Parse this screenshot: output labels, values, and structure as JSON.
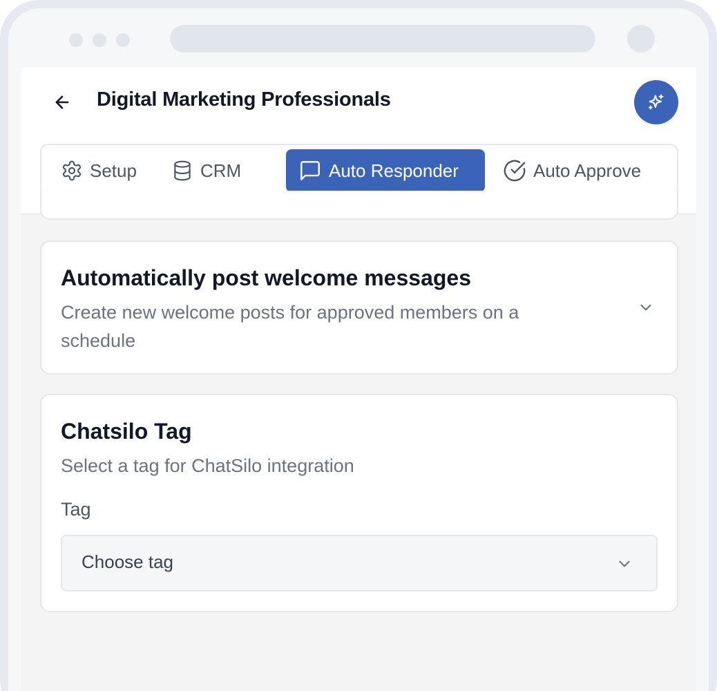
{
  "header": {
    "title": "Digital Marketing Professionals",
    "back_icon": "arrow-left-icon",
    "ai_icon": "sparkles-icon"
  },
  "tabs": [
    {
      "label": "Setup",
      "icon": "gear-icon",
      "active": false
    },
    {
      "label": "CRM",
      "icon": "database-icon",
      "active": false
    },
    {
      "label": "Auto Responder",
      "icon": "message-square-icon",
      "active": true
    },
    {
      "label": "Auto Approve",
      "icon": "check-circle-icon",
      "active": false
    }
  ],
  "welcome_section": {
    "title": "Automatically post welcome messages",
    "description": "Create new welcome posts for approved members on a schedule",
    "expanded": false
  },
  "chatsilo_section": {
    "title": "Chatsilo Tag",
    "description": "Select a tag for ChatSilo integration",
    "field_label": "Tag",
    "select_value": "Choose tag"
  },
  "colors": {
    "accent": "#3b63b8",
    "text_primary": "#111827",
    "text_secondary": "#6b7280",
    "background": "#f4f4f5"
  }
}
